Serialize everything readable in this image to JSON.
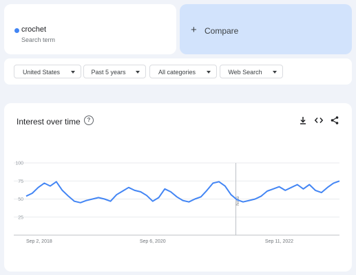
{
  "search_term": {
    "name": "crochet",
    "subtitle": "Search term",
    "color": "#4285f4"
  },
  "compare": {
    "plus": "+",
    "label": "Compare"
  },
  "filters": {
    "region": "United States",
    "time_range": "Past 5 years",
    "category": "All categories",
    "search_type": "Web Search"
  },
  "chart_panel": {
    "title": "Interest over time",
    "help_icon": "question-circle-icon",
    "tool_icons": [
      "download-icon",
      "embed-code-icon",
      "share-icon"
    ]
  },
  "chart_data": {
    "type": "line",
    "title": "Interest over time",
    "ylim": [
      0,
      100
    ],
    "yticks": [
      25,
      50,
      75,
      100
    ],
    "x_tick_labels": [
      {
        "date": "2018-09-02",
        "label": "Sep 2, 2018"
      },
      {
        "date": "2020-09-06",
        "label": "Sep 6, 2020"
      },
      {
        "date": "2022-09-11",
        "label": "Sep 11, 2022"
      }
    ],
    "x_range": [
      "2018-09-02",
      "2023-08-27"
    ],
    "grid": true,
    "line_color": "#4285f4",
    "annotation": {
      "date": "2022-01-02",
      "label": "Note"
    },
    "series": [
      {
        "x": [
          "2018-09-02",
          "2018-10-07",
          "2018-11-11",
          "2018-12-16",
          "2019-01-20",
          "2019-02-24",
          "2019-03-31",
          "2019-05-05",
          "2019-06-09",
          "2019-07-14",
          "2019-08-18",
          "2019-09-22",
          "2019-10-27",
          "2019-12-01",
          "2020-01-05",
          "2020-02-09",
          "2020-03-15",
          "2020-04-19",
          "2020-05-24",
          "2020-06-28",
          "2020-08-02",
          "2020-09-06",
          "2020-10-11",
          "2020-11-15",
          "2020-12-20",
          "2021-01-24",
          "2021-02-28",
          "2021-04-04",
          "2021-05-09",
          "2021-06-13",
          "2021-07-18",
          "2021-08-22",
          "2021-09-26",
          "2021-10-31",
          "2021-12-05",
          "2022-01-09",
          "2022-02-13",
          "2022-03-20",
          "2022-04-24",
          "2022-05-29",
          "2022-07-03",
          "2022-08-07",
          "2022-09-11",
          "2022-10-16",
          "2022-11-20",
          "2022-12-25",
          "2023-01-29",
          "2023-03-05",
          "2023-04-09",
          "2023-05-14",
          "2023-06-18",
          "2023-07-23",
          "2023-08-27"
        ],
        "y": [
          54,
          58,
          66,
          72,
          68,
          74,
          62,
          54,
          47,
          45,
          48,
          50,
          52,
          50,
          47,
          56,
          61,
          66,
          62,
          60,
          55,
          47,
          52,
          64,
          60,
          53,
          48,
          46,
          50,
          53,
          62,
          72,
          74,
          68,
          56,
          49,
          46,
          48,
          50,
          54,
          61,
          64,
          67,
          62,
          66,
          70,
          64,
          70,
          62,
          59,
          66,
          72,
          75
        ]
      }
    ]
  }
}
